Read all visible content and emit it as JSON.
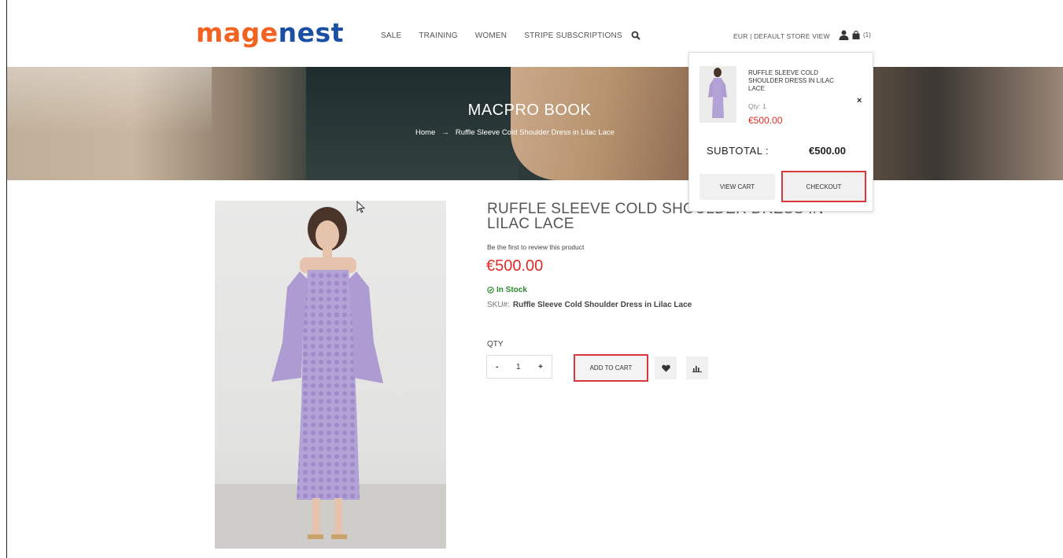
{
  "header": {
    "logo_part1": "mage",
    "logo_part2": "nest",
    "nav": [
      "SALE",
      "TRAINING",
      "WOMEN",
      "STRIPE SUBSCRIPTIONS"
    ],
    "store_switcher": "EUR | DEFAULT STORE VIEW",
    "cart_count": "(1)"
  },
  "banner": {
    "title": "MACPRO BOOK",
    "breadcrumb_home": "Home",
    "breadcrumb_arrow": "→",
    "breadcrumb_current": "Ruffle Sleeve Cold Shoulder Dress in Lilac Lace"
  },
  "product": {
    "title": "RUFFLE SLEEVE COLD SHOULDER DRESS IN LILAC LACE",
    "review_link": "Be the first to review this product",
    "price": "€500.00",
    "stock": "In Stock",
    "sku_label": "SKU#:",
    "sku_value": "Ruffle Sleeve Cold Shoulder Dress in Lilac Lace",
    "qty_label": "QTY",
    "qty_minus": "-",
    "qty_value": "1",
    "qty_plus": "+",
    "add_to_cart": "ADD TO CART"
  },
  "minicart": {
    "item_name": "RUFFLE SLEEVE COLD SHOULDER DRESS IN LILAC LACE",
    "item_qty": "Qty: 1",
    "item_price": "€500.00",
    "close": "×",
    "subtotal_label": "SUBTOTAL :",
    "subtotal_value": "€500.00",
    "view_cart": "VIEW CART",
    "checkout": "CHECKOUT"
  },
  "colors": {
    "brand_orange": "#f26322",
    "brand_blue": "#1a4fa3",
    "price_red": "#e02b27",
    "highlight_border": "#d9363e",
    "stock_green": "#2a8a2a"
  }
}
